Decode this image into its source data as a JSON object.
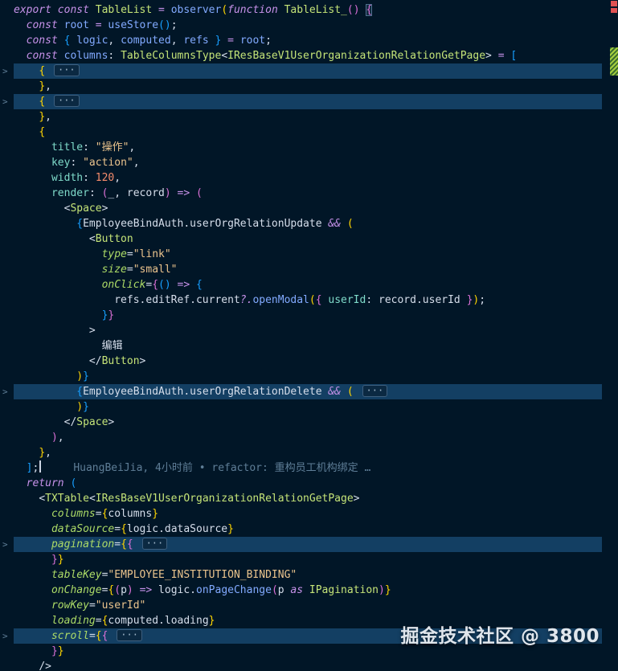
{
  "colors": {
    "bg": "#011627",
    "fold": "#133f63",
    "pl": "#d6deeb",
    "kw": "#c792ea",
    "grn": "#c5e478",
    "blu": "#82aaff",
    "prop": "#7fdbca",
    "str": "#ecc48d",
    "num": "#f78c6c",
    "attr": "#addb67",
    "b1": "#ffd602",
    "b2": "#da70d6",
    "b3": "#179fff",
    "blame": "#5f7e97",
    "chevron": "#5f7e97",
    "ruler_red": "#e05252",
    "ruler_green_a": "#a6cf3d",
    "ruler_green_b": "#3c6e2f"
  },
  "watermark": {
    "text": "掘金技术社区 @ 3800"
  },
  "editor": {
    "fold_badge": "···",
    "gutter_chevron": ">",
    "lines": [
      {
        "tokens": [
          [
            "export ",
            "kw"
          ],
          [
            "const ",
            "kw"
          ],
          [
            "TableList ",
            "grn"
          ],
          [
            "= ",
            "kw"
          ],
          [
            "observer",
            "blu"
          ],
          [
            "(",
            "b1"
          ],
          [
            "function ",
            "kw"
          ],
          [
            "TableList_",
            "grn"
          ],
          [
            "()",
            "b2"
          ],
          [
            " ",
            "pl"
          ],
          [
            "{",
            "b2 match"
          ]
        ]
      },
      {
        "tokens": [
          [
            "  ",
            "pl"
          ],
          [
            "const ",
            "kw"
          ],
          [
            "root ",
            "blu"
          ],
          [
            "= ",
            "kw"
          ],
          [
            "useStore",
            "blu"
          ],
          [
            "()",
            "b3"
          ],
          [
            ";",
            "pl"
          ]
        ]
      },
      {
        "tokens": [
          [
            "  ",
            "pl"
          ],
          [
            "const ",
            "kw"
          ],
          [
            "{ ",
            "b3"
          ],
          [
            "logic",
            "blu"
          ],
          [
            ", ",
            "pl"
          ],
          [
            "computed",
            "blu"
          ],
          [
            ", ",
            "pl"
          ],
          [
            "refs",
            "blu"
          ],
          [
            " ",
            "pl"
          ],
          [
            "}",
            "b3"
          ],
          [
            " ",
            "pl"
          ],
          [
            "= ",
            "kw"
          ],
          [
            "root",
            "blu"
          ],
          [
            ";",
            "pl"
          ]
        ]
      },
      {
        "tokens": [
          [
            "  ",
            "pl"
          ],
          [
            "const ",
            "kw"
          ],
          [
            "columns",
            "blu"
          ],
          [
            ": ",
            "pl"
          ],
          [
            "TableColumnsType",
            "grn"
          ],
          [
            "<",
            "pl"
          ],
          [
            "IResBaseV1UserOrganizationRelationGetPage",
            "grn"
          ],
          [
            "> ",
            "pl"
          ],
          [
            "= ",
            "kw"
          ],
          [
            "[",
            "b3"
          ]
        ]
      },
      {
        "folded": true,
        "chevron": true,
        "tokens": [
          [
            "    ",
            "pl"
          ],
          [
            "{ ",
            "b1"
          ]
        ]
      },
      {
        "tokens": [
          [
            "    ",
            "pl"
          ],
          [
            "}",
            "b1"
          ],
          [
            ",",
            "pl"
          ]
        ]
      },
      {
        "folded": true,
        "chevron": true,
        "tokens": [
          [
            "    ",
            "pl"
          ],
          [
            "{ ",
            "b1"
          ]
        ]
      },
      {
        "tokens": [
          [
            "    ",
            "pl"
          ],
          [
            "}",
            "b1"
          ],
          [
            ",",
            "pl"
          ]
        ]
      },
      {
        "tokens": [
          [
            "    ",
            "pl"
          ],
          [
            "{",
            "b1"
          ]
        ]
      },
      {
        "tokens": [
          [
            "      ",
            "pl"
          ],
          [
            "title",
            "prop"
          ],
          [
            ": ",
            "pl"
          ],
          [
            "\"操作\"",
            "str"
          ],
          [
            ",",
            "pl"
          ]
        ]
      },
      {
        "tokens": [
          [
            "      ",
            "pl"
          ],
          [
            "key",
            "prop"
          ],
          [
            ": ",
            "pl"
          ],
          [
            "\"action\"",
            "str"
          ],
          [
            ",",
            "pl"
          ]
        ]
      },
      {
        "tokens": [
          [
            "      ",
            "pl"
          ],
          [
            "width",
            "prop"
          ],
          [
            ": ",
            "pl"
          ],
          [
            "120",
            "num"
          ],
          [
            ",",
            "pl"
          ]
        ]
      },
      {
        "tokens": [
          [
            "      ",
            "pl"
          ],
          [
            "render",
            "prop"
          ],
          [
            ": ",
            "pl"
          ],
          [
            "(",
            "b2"
          ],
          [
            "_, record",
            "pl"
          ],
          [
            ")",
            "b2"
          ],
          [
            " ",
            "pl"
          ],
          [
            "=>",
            "kw"
          ],
          [
            " ",
            "pl"
          ],
          [
            "(",
            "b2"
          ]
        ]
      },
      {
        "tokens": [
          [
            "        ",
            "pl"
          ],
          [
            "<",
            "pl"
          ],
          [
            "Space",
            "grn"
          ],
          [
            ">",
            "pl"
          ]
        ]
      },
      {
        "tokens": [
          [
            "          ",
            "pl"
          ],
          [
            "{",
            "b3"
          ],
          [
            "EmployeeBindAuth.userOrgRelationUpdate ",
            "pl"
          ],
          [
            "&& ",
            "kw"
          ],
          [
            "(",
            "b1"
          ]
        ]
      },
      {
        "tokens": [
          [
            "            ",
            "pl"
          ],
          [
            "<",
            "pl"
          ],
          [
            "Button",
            "grn"
          ]
        ]
      },
      {
        "tokens": [
          [
            "              ",
            "pl"
          ],
          [
            "type",
            "attr"
          ],
          [
            "=",
            "pl"
          ],
          [
            "\"link\"",
            "str"
          ]
        ]
      },
      {
        "tokens": [
          [
            "              ",
            "pl"
          ],
          [
            "size",
            "attr"
          ],
          [
            "=",
            "pl"
          ],
          [
            "\"small\"",
            "str"
          ]
        ]
      },
      {
        "tokens": [
          [
            "              ",
            "pl"
          ],
          [
            "onClick",
            "attr"
          ],
          [
            "=",
            "pl"
          ],
          [
            "{",
            "b2"
          ],
          [
            "()",
            "b3"
          ],
          [
            " ",
            "pl"
          ],
          [
            "=>",
            "kw"
          ],
          [
            " ",
            "pl"
          ],
          [
            "{",
            "b3"
          ]
        ]
      },
      {
        "tokens": [
          [
            "                ",
            "pl"
          ],
          [
            "refs.editRef.current",
            "pl"
          ],
          [
            "?.",
            "kw"
          ],
          [
            "openModal",
            "blu"
          ],
          [
            "(",
            "b1"
          ],
          [
            "{",
            "b2"
          ],
          [
            " ",
            "pl"
          ],
          [
            "userId",
            "prop"
          ],
          [
            ": ",
            "pl"
          ],
          [
            "record.userId",
            "pl"
          ],
          [
            " ",
            "pl"
          ],
          [
            "}",
            "b2"
          ],
          [
            ")",
            "b1"
          ],
          [
            ";",
            "pl"
          ]
        ]
      },
      {
        "tokens": [
          [
            "              ",
            "pl"
          ],
          [
            "}",
            "b3"
          ],
          [
            "}",
            "b2"
          ]
        ]
      },
      {
        "tokens": [
          [
            "            ",
            "pl"
          ],
          [
            ">",
            "pl"
          ]
        ]
      },
      {
        "tokens": [
          [
            "              ",
            "pl"
          ],
          [
            "编辑",
            "pl"
          ]
        ]
      },
      {
        "tokens": [
          [
            "            ",
            "pl"
          ],
          [
            "</",
            "pl"
          ],
          [
            "Button",
            "grn"
          ],
          [
            ">",
            "pl"
          ]
        ]
      },
      {
        "tokens": [
          [
            "          ",
            "pl"
          ],
          [
            ")",
            "b1"
          ],
          [
            "}",
            "b3"
          ]
        ]
      },
      {
        "folded": true,
        "chevron": true,
        "tokens": [
          [
            "          ",
            "pl"
          ],
          [
            "{",
            "b3"
          ],
          [
            "EmployeeBindAuth.userOrgRelationDelete ",
            "pl"
          ],
          [
            "&& ",
            "kw"
          ],
          [
            "( ",
            "b1"
          ]
        ]
      },
      {
        "tokens": [
          [
            "          ",
            "pl"
          ],
          [
            ")",
            "b1"
          ],
          [
            "}",
            "b3"
          ]
        ]
      },
      {
        "tokens": [
          [
            "        ",
            "pl"
          ],
          [
            "</",
            "pl"
          ],
          [
            "Space",
            "grn"
          ],
          [
            ">",
            "pl"
          ]
        ]
      },
      {
        "tokens": [
          [
            "      ",
            "pl"
          ],
          [
            ")",
            "b2"
          ],
          [
            ",",
            "pl"
          ]
        ]
      },
      {
        "tokens": [
          [
            "    ",
            "pl"
          ],
          [
            "}",
            "b1"
          ],
          [
            ",",
            "pl"
          ]
        ]
      },
      {
        "cursor": true,
        "blame": "HuangBeiJia, 4小时前 • refactor: 重构员工机构绑定 …",
        "tokens": [
          [
            "  ",
            "pl"
          ],
          [
            "]",
            "b3"
          ],
          [
            ";",
            "pl"
          ]
        ]
      },
      {
        "tokens": [
          [
            "  ",
            "pl"
          ],
          [
            "return ",
            "kw"
          ],
          [
            "(",
            "b3"
          ]
        ]
      },
      {
        "tokens": [
          [
            "    ",
            "pl"
          ],
          [
            "<",
            "pl"
          ],
          [
            "TXTable",
            "grn"
          ],
          [
            "<",
            "pl"
          ],
          [
            "IResBaseV1UserOrganizationRelationGetPage",
            "grn"
          ],
          [
            ">",
            "pl"
          ]
        ]
      },
      {
        "tokens": [
          [
            "      ",
            "pl"
          ],
          [
            "columns",
            "attr"
          ],
          [
            "=",
            "pl"
          ],
          [
            "{",
            "b1"
          ],
          [
            "columns",
            "pl"
          ],
          [
            "}",
            "b1"
          ]
        ]
      },
      {
        "tokens": [
          [
            "      ",
            "pl"
          ],
          [
            "dataSource",
            "attr"
          ],
          [
            "=",
            "pl"
          ],
          [
            "{",
            "b1"
          ],
          [
            "logic.dataSource",
            "pl"
          ],
          [
            "}",
            "b1"
          ]
        ]
      },
      {
        "folded": true,
        "chevron": true,
        "tokens": [
          [
            "      ",
            "pl"
          ],
          [
            "pagination",
            "attr"
          ],
          [
            "=",
            "pl"
          ],
          [
            "{",
            "b1"
          ],
          [
            "{ ",
            "b2"
          ]
        ]
      },
      {
        "tokens": [
          [
            "      ",
            "pl"
          ],
          [
            "}",
            "b2"
          ],
          [
            "}",
            "b1"
          ]
        ]
      },
      {
        "tokens": [
          [
            "      ",
            "pl"
          ],
          [
            "tableKey",
            "attr"
          ],
          [
            "=",
            "pl"
          ],
          [
            "\"EMPLOYEE_INSTITUTION_BINDING\"",
            "str"
          ]
        ]
      },
      {
        "tokens": [
          [
            "      ",
            "pl"
          ],
          [
            "onChange",
            "attr"
          ],
          [
            "=",
            "pl"
          ],
          [
            "{",
            "b1"
          ],
          [
            "(",
            "b2"
          ],
          [
            "p",
            "pl"
          ],
          [
            ")",
            "b2"
          ],
          [
            " ",
            "pl"
          ],
          [
            "=>",
            "kw"
          ],
          [
            " ",
            "pl"
          ],
          [
            "logic.",
            "pl"
          ],
          [
            "onPageChange",
            "blu"
          ],
          [
            "(",
            "b2"
          ],
          [
            "p ",
            "pl"
          ],
          [
            "as ",
            "kw"
          ],
          [
            "IPagination",
            "grn"
          ],
          [
            ")",
            "b2"
          ],
          [
            "}",
            "b1"
          ]
        ]
      },
      {
        "tokens": [
          [
            "      ",
            "pl"
          ],
          [
            "rowKey",
            "attr"
          ],
          [
            "=",
            "pl"
          ],
          [
            "\"userId\"",
            "str"
          ]
        ]
      },
      {
        "tokens": [
          [
            "      ",
            "pl"
          ],
          [
            "loading",
            "attr"
          ],
          [
            "=",
            "pl"
          ],
          [
            "{",
            "b1"
          ],
          [
            "computed.loading",
            "pl"
          ],
          [
            "}",
            "b1"
          ]
        ]
      },
      {
        "folded": true,
        "chevron": true,
        "tokens": [
          [
            "      ",
            "pl"
          ],
          [
            "scroll",
            "attr"
          ],
          [
            "=",
            "pl"
          ],
          [
            "{",
            "b1"
          ],
          [
            "{ ",
            "b2"
          ]
        ]
      },
      {
        "tokens": [
          [
            "      ",
            "pl"
          ],
          [
            "}",
            "b2"
          ],
          [
            "}",
            "b1"
          ]
        ]
      },
      {
        "tokens": [
          [
            "    ",
            "pl"
          ],
          [
            "/>",
            "pl"
          ]
        ]
      }
    ]
  }
}
